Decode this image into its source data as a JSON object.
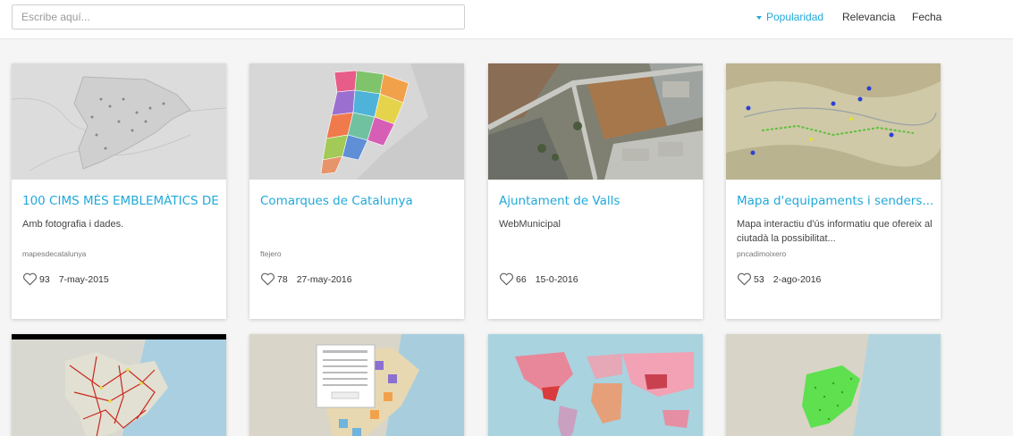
{
  "search": {
    "placeholder": "Escribe aquí..."
  },
  "sort": {
    "options": [
      "Popularidad",
      "Relevancia",
      "Fecha"
    ],
    "active": "Popularidad"
  },
  "accent_color": "#21a9d8",
  "cards": [
    {
      "title": "100 CIMS MÉS EMBLEMÀTICS DE ...",
      "description": "Amb fotografia i dades.",
      "author": "mapesdecatalunya",
      "likes": "93",
      "date": "7-may-2015",
      "thumb": "grey-map-icon"
    },
    {
      "title": "Comarques de Catalunya",
      "description": "",
      "author": "ftejero",
      "likes": "78",
      "date": "27-may-2016",
      "thumb": "colored-regions-map-icon"
    },
    {
      "title": "Ajuntament de Valls",
      "description": "WebMunicipal",
      "author": "",
      "likes": "66",
      "date": "15-0-2016",
      "thumb": "aerial-photo-icon"
    },
    {
      "title": "Mapa d'equipaments i senders...",
      "description": "Mapa interactiu d'ús informatiu que ofereix al ciutadà la possibilitat...",
      "author": "pncadimoixero",
      "likes": "53",
      "date": "2-ago-2016",
      "thumb": "terrain-map-icon"
    },
    {
      "thumb": "roads-map-icon"
    },
    {
      "thumb": "popup-map-icon"
    },
    {
      "thumb": "world-map-icon"
    },
    {
      "thumb": "green-region-map-icon"
    }
  ]
}
